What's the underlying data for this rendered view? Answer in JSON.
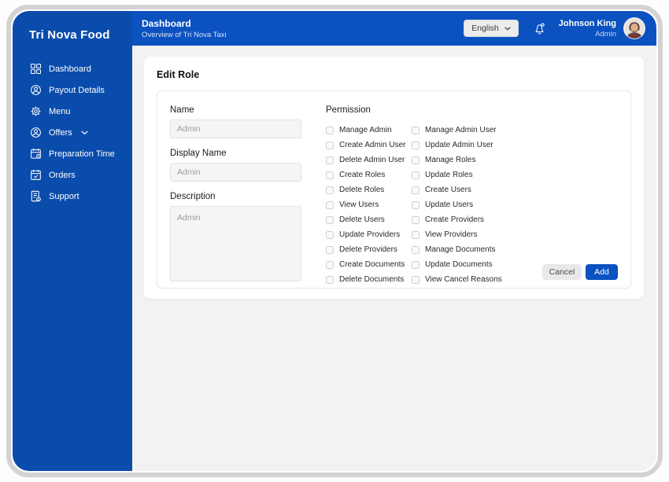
{
  "sidebar": {
    "brand": "Tri Nova Food",
    "items": [
      {
        "label": "Dashboard",
        "icon": "dashboard-grid-icon"
      },
      {
        "label": "Payout Details",
        "icon": "user-circle-icon"
      },
      {
        "label": "Menu",
        "icon": "gear-icon"
      },
      {
        "label": "Offers",
        "icon": "user-circle-icon",
        "has_chevron": true
      },
      {
        "label": "Preparation Time",
        "icon": "calendar-clock-icon"
      },
      {
        "label": "Orders",
        "icon": "calendar-check-icon"
      },
      {
        "label": "Support",
        "icon": "document-badge-icon"
      }
    ]
  },
  "header": {
    "title": "Dashboard",
    "subtitle": "Overview of Tri Nova Taxi",
    "language_selector": {
      "value": "English",
      "icon": "chevron-down-icon"
    },
    "notification_icon": "bell-icon",
    "user": {
      "name": "Johnson King",
      "role": "Admin"
    }
  },
  "main": {
    "page_title": "Edit Role",
    "form": {
      "fields": [
        {
          "label": "Name",
          "value": "Admin",
          "type": "input"
        },
        {
          "label": "Display Name",
          "value": "Admin",
          "type": "input"
        },
        {
          "label": "Description",
          "value": "Admin",
          "type": "textarea"
        }
      ]
    },
    "permissions": {
      "title": "Permission",
      "checked_state_all": false,
      "columns": [
        [
          "Manage Admin",
          "Create Admin User",
          "Delete Admin User",
          "Create Roles",
          "Delete Roles",
          "View Users",
          "Delete Users",
          "Update Providers",
          "Delete Providers",
          "Create Documents",
          "Delete Documents"
        ],
        [
          "Manage Admin User",
          "Update Admin User",
          "Manage Roles",
          "Update Roles",
          "Create Users",
          "Update Users",
          "Create Providers",
          "View Providers",
          "Manage Documents",
          "Update Documents",
          "View Cancel Reasons"
        ]
      ]
    },
    "actions": {
      "cancel": "Cancel",
      "add": "Add"
    }
  },
  "colors": {
    "sidebar_blue": "#0a4cab",
    "header_blue": "#0b52c0",
    "accent_blue": "#0b52c0",
    "content_bg": "#f2f2f2",
    "window_border": "#d3d3d3",
    "card_bg": "#ffffff",
    "input_bg": "#f5f5f5",
    "cancel_bg": "#e9e9e9"
  }
}
